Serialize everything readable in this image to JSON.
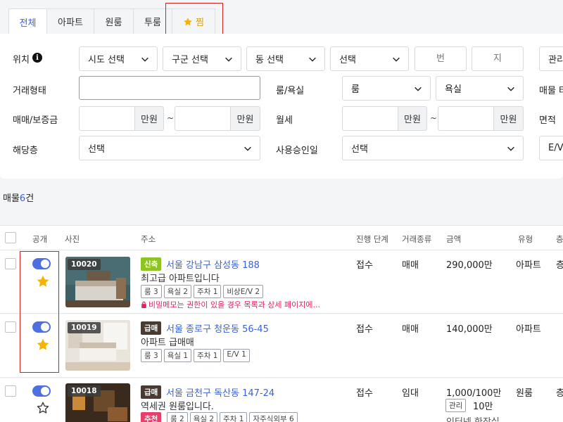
{
  "tabs": [
    {
      "label": "전체",
      "active": true
    },
    {
      "label": "아파트",
      "active": false
    },
    {
      "label": "원룸",
      "active": false
    },
    {
      "label": "투룸",
      "active": false
    },
    {
      "label": "찜",
      "active": false
    }
  ],
  "filters": {
    "location": {
      "label": "위치",
      "sido": "시도 선택",
      "gugun": "구군 선택",
      "dong": "동 선택",
      "select": "선택",
      "bun_placeholder": "번",
      "ji_placeholder": "지",
      "manage": "관리"
    },
    "trade": {
      "label": "거래형태",
      "value": ""
    },
    "room": {
      "label": "룸/욕실",
      "room": "룸",
      "bath": "욕실",
      "extra": "매물 타"
    },
    "deposit": {
      "label": "매매/보증금",
      "unit": "만원",
      "tilde": "~"
    },
    "monthly": {
      "label": "월세",
      "unit": "만원",
      "tilde": "~"
    },
    "area": {
      "label": "면적"
    },
    "floor": {
      "label": "해당층",
      "value": "선택"
    },
    "approval": {
      "label": "사용승인일",
      "value": "선택"
    },
    "ev": {
      "label": "E/V"
    }
  },
  "listing_count": {
    "prefix": "매물",
    "count": "6",
    "suffix": "건"
  },
  "table": {
    "headers": {
      "public": "공개",
      "photo": "사진",
      "address": "주소",
      "stage": "진행 단계",
      "trade": "거래종류",
      "amount": "금액",
      "type": "유형",
      "floor": "층"
    },
    "rows": [
      {
        "id": "10020",
        "badge": "신축",
        "badge_kind": "new",
        "address": "서울 강남구 삼성동 188",
        "desc": "최고급 아파트입니다",
        "chips": [
          "룸 3",
          "욕실 2",
          "주차 1",
          "비상E/V 2"
        ],
        "memo": "비밀메모는 권한이 있을 경우 목록과 상세 페이지에...",
        "stage": "접수",
        "trade": "매매",
        "amount": "290,000만",
        "type": "아파트",
        "floor": "층",
        "starred": true
      },
      {
        "id": "10019",
        "badge": "급매",
        "badge_kind": "urgent",
        "address": "서울 종로구 청운동 56-45",
        "desc": "아파트 급매매",
        "chips": [
          "룸 3",
          "욕실 1",
          "주차 1",
          "E/V 1"
        ],
        "stage": "접수",
        "trade": "매매",
        "amount": "140,000만",
        "type": "아파트",
        "starred": true
      },
      {
        "id": "10018",
        "badge": "급매",
        "badge_kind": "urgent",
        "badge2": "추천",
        "address": "서울 금천구 독산동 147-24",
        "desc": "역세권 원룸입니다.",
        "chips": [
          "룸 2",
          "욕실 2",
          "주차 1",
          "자주식외부 6"
        ],
        "stage": "접수",
        "trade": "임대",
        "amount": "1,000/100만",
        "mgmt_label": "관리",
        "mgmt_value": "10만",
        "extra": "인터넷 한장실",
        "type": "원룸",
        "floor": "층",
        "starred": false
      }
    ]
  },
  "colors": {
    "accent": "#3a62d6",
    "toggle": "#4e6fe0",
    "star": "#f5b400",
    "highlight": "#d32020"
  }
}
